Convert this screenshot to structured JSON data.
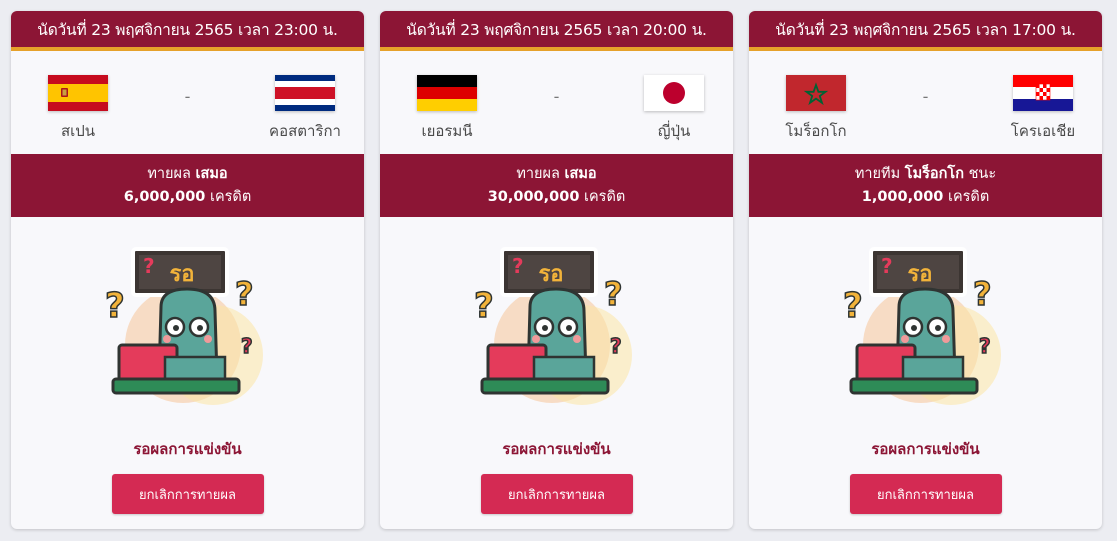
{
  "cards": [
    {
      "date_label": "นัดวันที่ 23 พฤศจิกายน 2565 เวลา 23:00 น.",
      "home": {
        "name": "สเปน",
        "flag_icon": "spain-flag-icon"
      },
      "away": {
        "name": "คอสตาริกา",
        "flag_icon": "costa-rica-flag-icon"
      },
      "vs": "-",
      "bet_prefix": "ทายผล",
      "bet_pick": "เสมอ",
      "bet_suffix": "",
      "bet_amount": "6,000,000",
      "bet_unit": "เครดิต",
      "sign_text": "รอ",
      "status": "รอผลการแข่งขัน",
      "cancel_label": "ยกเลิกการทายผล"
    },
    {
      "date_label": "นัดวันที่ 23 พฤศจิกายน 2565 เวลา 20:00 น.",
      "home": {
        "name": "เยอรมนี",
        "flag_icon": "germany-flag-icon"
      },
      "away": {
        "name": "ญี่ปุ่น",
        "flag_icon": "japan-flag-icon"
      },
      "vs": "-",
      "bet_prefix": "ทายผล",
      "bet_pick": "เสมอ",
      "bet_suffix": "",
      "bet_amount": "30,000,000",
      "bet_unit": "เครดิต",
      "sign_text": "รอ",
      "status": "รอผลการแข่งขัน",
      "cancel_label": "ยกเลิกการทายผล"
    },
    {
      "date_label": "นัดวันที่ 23 พฤศจิกายน 2565 เวลา 17:00 น.",
      "home": {
        "name": "โมร็อกโก",
        "flag_icon": "morocco-flag-icon"
      },
      "away": {
        "name": "โครเอเชีย",
        "flag_icon": "croatia-flag-icon"
      },
      "vs": "-",
      "bet_prefix": "ทายทีม",
      "bet_pick": "โมร็อกโก",
      "bet_suffix": "ชนะ",
      "bet_amount": "1,000,000",
      "bet_unit": "เครดิต",
      "sign_text": "รอ",
      "status": "รอผลการแข่งขัน",
      "cancel_label": "ยกเลิกการทายผล"
    }
  ]
}
